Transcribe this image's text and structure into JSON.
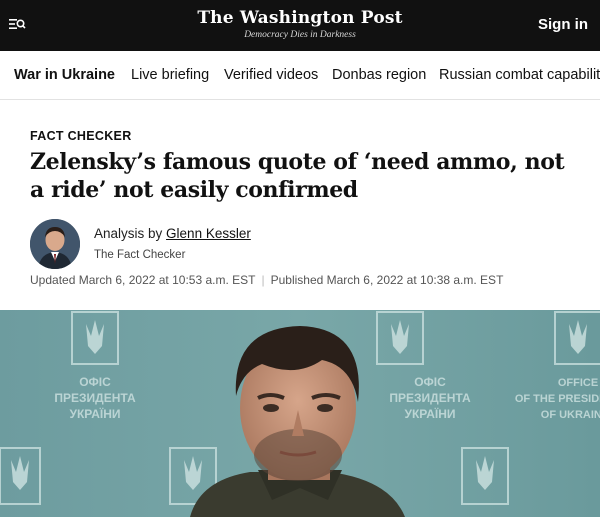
{
  "header": {
    "logo": "The Washington Post",
    "tagline": "Democracy Dies in Darkness",
    "signin_label": "Sign in",
    "menu_icon": "menu-search-icon"
  },
  "nav": {
    "items": [
      {
        "label": "War in Ukraine",
        "active": true
      },
      {
        "label": "Live briefing"
      },
      {
        "label": "Verified videos"
      },
      {
        "label": "Donbas region"
      },
      {
        "label": "Russian combat capabilities"
      }
    ]
  },
  "article": {
    "kicker": "FACT CHECKER",
    "headline": "Zelensky’s famous quote of ‘need ammo, not a ride’ not easily confirmed",
    "byline_prefix": "Analysis by",
    "author": "Glenn Kessler",
    "column": "The Fact Checker",
    "updated": "Updated March 6, 2022 at 10:53 a.m. EST",
    "published": "Published March 6, 2022 at 10:38 a.m. EST",
    "photo_backdrop_text": [
      "ОФІС",
      "ПРЕЗИДЕНТА",
      "УКРАЇНИ"
    ],
    "photo_backdrop_text_right": [
      "OFFICE",
      "OF THE PRESIDENT",
      "OF UKRAINE"
    ]
  },
  "colors": {
    "topbar": "#111111",
    "photo_backdrop": "#6f9fa1"
  }
}
